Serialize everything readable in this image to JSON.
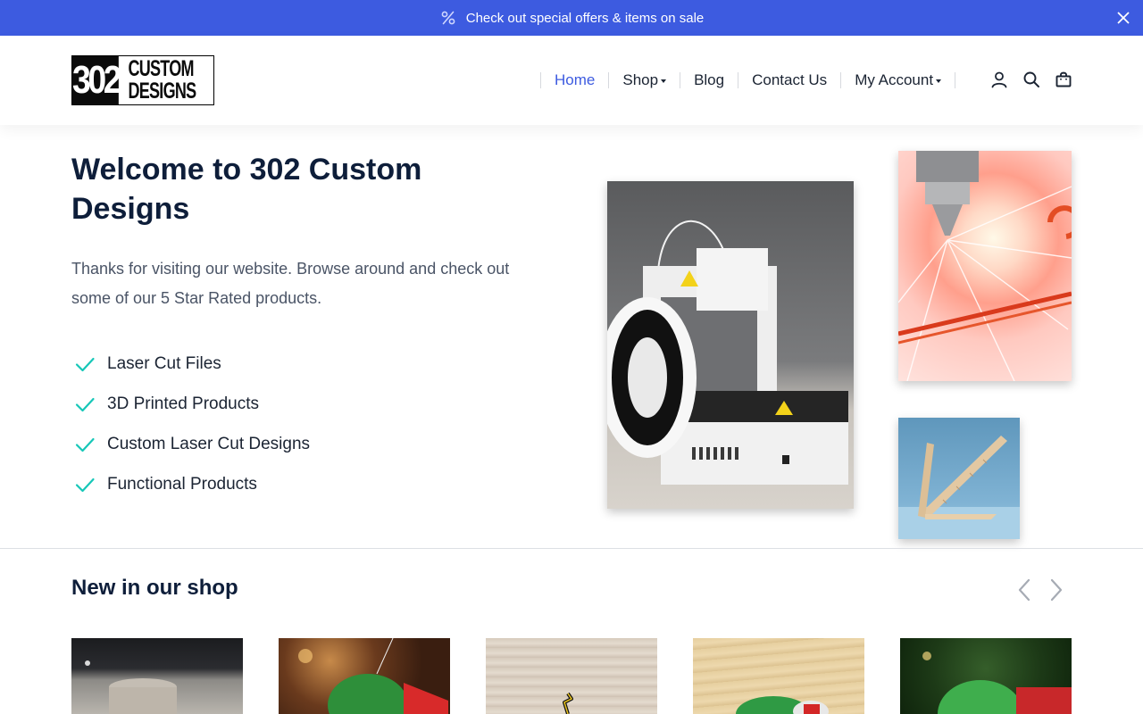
{
  "announcement": {
    "text": "Check out special offers & items on sale",
    "background": "#3d5be0",
    "icon": "percent-icon",
    "close_icon": "close-icon"
  },
  "brand": {
    "logo_number": "302",
    "logo_line1": "CUSTOM",
    "logo_line2": "DESIGNS"
  },
  "nav": {
    "items": [
      {
        "label": "Home",
        "active": true,
        "dropdown": false
      },
      {
        "label": "Shop",
        "active": false,
        "dropdown": true
      },
      {
        "label": "Blog",
        "active": false,
        "dropdown": false
      },
      {
        "label": "Contact Us",
        "active": false,
        "dropdown": false
      },
      {
        "label": "My Account",
        "active": false,
        "dropdown": true
      }
    ],
    "icons": [
      "account-icon",
      "search-icon",
      "cart-icon"
    ],
    "active_color": "#3d5be0"
  },
  "hero": {
    "title": "Welcome to 302 Custom Designs",
    "text": "Thanks for visiting our website. Browse around and check out some of our 5 Star Rated products.",
    "features": [
      "Laser Cut Files",
      "3D Printed Products",
      "Custom Laser Cut Designs",
      "Functional Products"
    ],
    "check_color": "#16c7b8",
    "images": [
      "3d-printer-photo",
      "laser-cutter-photo",
      "wooden-ruler-photo"
    ]
  },
  "shop": {
    "title": "New in our shop",
    "prev_icon": "chevron-left-icon",
    "next_icon": "chevron-right-icon",
    "products": [
      "product-image-1",
      "product-image-2",
      "product-image-3",
      "product-image-4",
      "product-image-5"
    ]
  }
}
